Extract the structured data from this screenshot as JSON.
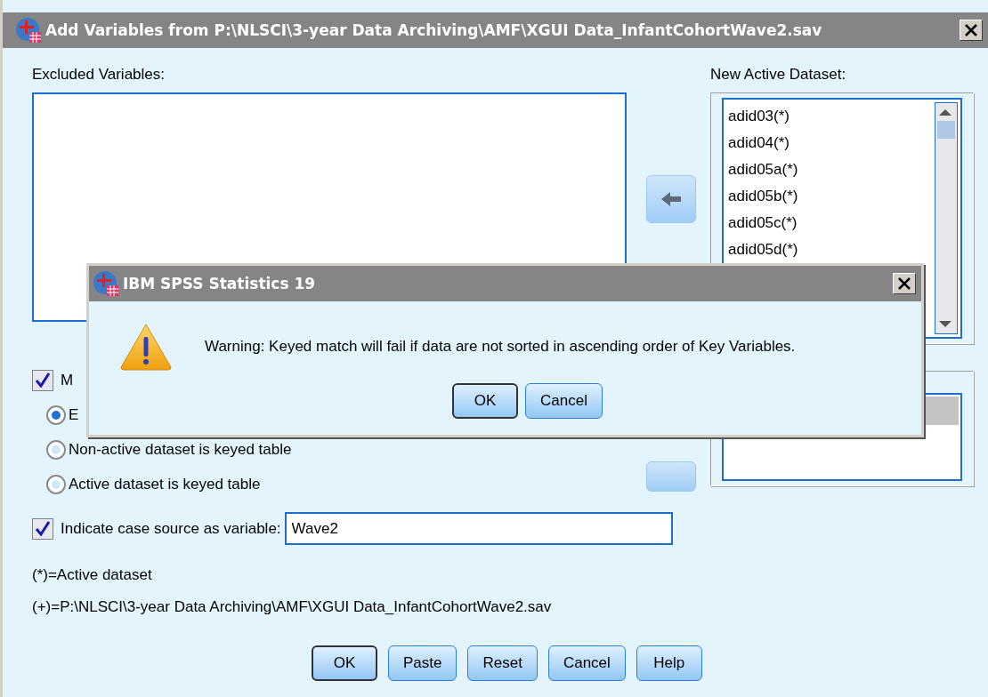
{
  "main_window": {
    "title": "Add Variables from P:\\NLSCI\\3-year Data Archiving\\AMF\\XGUI Data_InfantCohortWave2.sav",
    "excluded_variables": {
      "label": "Excluded Variables:"
    },
    "new_active_dataset": {
      "label": "New Active Dataset:",
      "items": [
        "adid03(*)",
        "adid04(*)",
        "adid05a(*)",
        "adid05b(*)",
        "adid05c(*)",
        "adid05d(*)"
      ]
    },
    "match_checkbox": {
      "label": "M",
      "checked": true
    },
    "key_options": [
      {
        "label": "E",
        "selected": true
      },
      {
        "label": "Non-active dataset is keyed table",
        "selected": false
      },
      {
        "label": "Active dataset is keyed table",
        "selected": false
      }
    ],
    "case_source": {
      "label": "Indicate case source as variable:",
      "checked": true,
      "value": "Wave2"
    },
    "notes": [
      "(*)=Active dataset",
      "(+)=P:\\NLSCI\\3-year Data Archiving\\AMF\\XGUI Data_InfantCohortWave2.sav"
    ],
    "buttons": [
      {
        "label": "OK",
        "default": true
      },
      {
        "label": "Paste",
        "default": false
      },
      {
        "label": "Reset",
        "default": false
      },
      {
        "label": "Cancel",
        "default": false
      },
      {
        "label": "Help",
        "default": false
      }
    ]
  },
  "alert": {
    "title": "IBM SPSS Statistics 19",
    "message": "Warning: Keyed match will fail if data are not sorted in ascending order of Key Variables.",
    "buttons": [
      {
        "label": "OK",
        "default": true
      },
      {
        "label": "Cancel",
        "default": false
      }
    ]
  }
}
